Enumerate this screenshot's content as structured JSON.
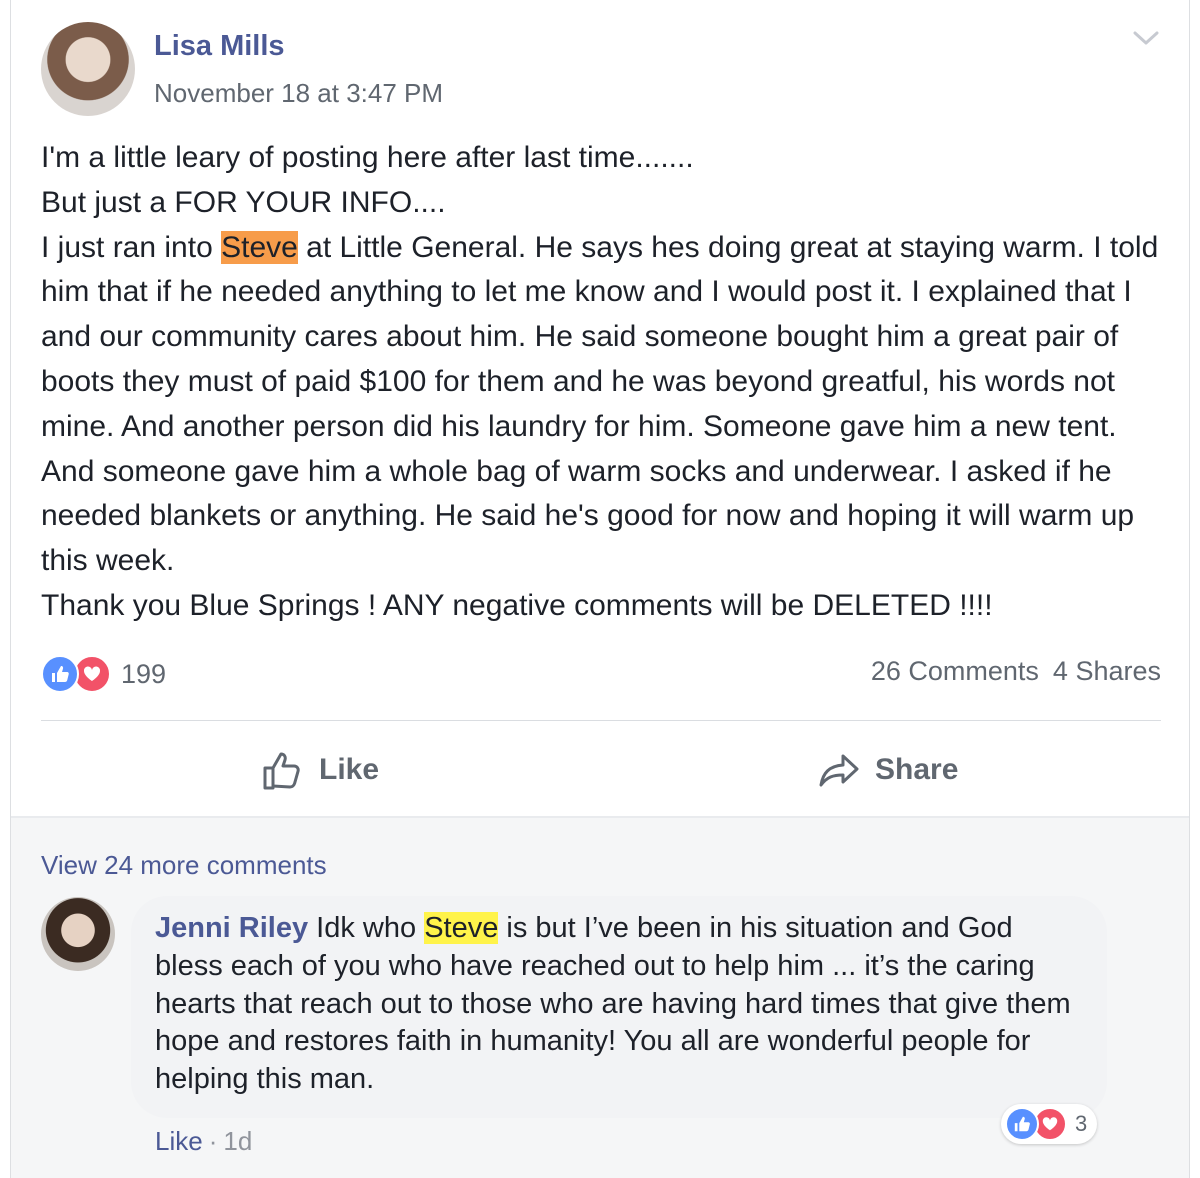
{
  "post": {
    "author": "Lisa Mills",
    "timestamp": "November 18 at 3:47 PM",
    "lines": {
      "l1": "I'm a little leary of posting here after last time.......",
      "l2": "But just a FOR YOUR INFO....",
      "l3_pre": "I just ran into ",
      "l3_hl": "Steve",
      "l3_post": " at Little General. He says hes doing great at staying warm. I told him that if he needed anything to let me know and I would post it. I explained that I and our community cares about him. He said someone bought him a great pair of boots they must of paid $100 for them and he was beyond greatful, his words not mine. And another person did his laundry for him. Someone gave him a new tent. And someone gave him a whole bag of warm socks and underwear. I asked if he needed blankets or anything. He said he's good for now and hoping it will warm up this week.",
      "l4": "Thank you Blue Springs ! ANY negative comments will be DELETED !!!!"
    },
    "reaction_count": "199",
    "comments_count": "26 Comments",
    "shares_count": "4 Shares",
    "like_label": "Like",
    "share_label": "Share"
  },
  "comments": {
    "view_more": "View 24 more comments",
    "items": [
      {
        "author": "Jenni Riley",
        "text_pre": " Idk who ",
        "text_hl": "Steve",
        "text_post": " is but I’ve been in his situation and God bless each of you who have reached out to help him ... it’s the caring hearts that reach out to those who are having hard times that give them hope and restores faith in humanity! You all are wonderful people for helping this man.",
        "reaction_count": "3",
        "like_label": "Like",
        "separator": "·",
        "age": "1d"
      }
    ]
  },
  "colors": {
    "link": "#4b5995",
    "like_blue": "#5890ff",
    "love_red": "#f25268",
    "highlight_orange": "#f79c4a",
    "highlight_yellow": "#fff34a"
  }
}
